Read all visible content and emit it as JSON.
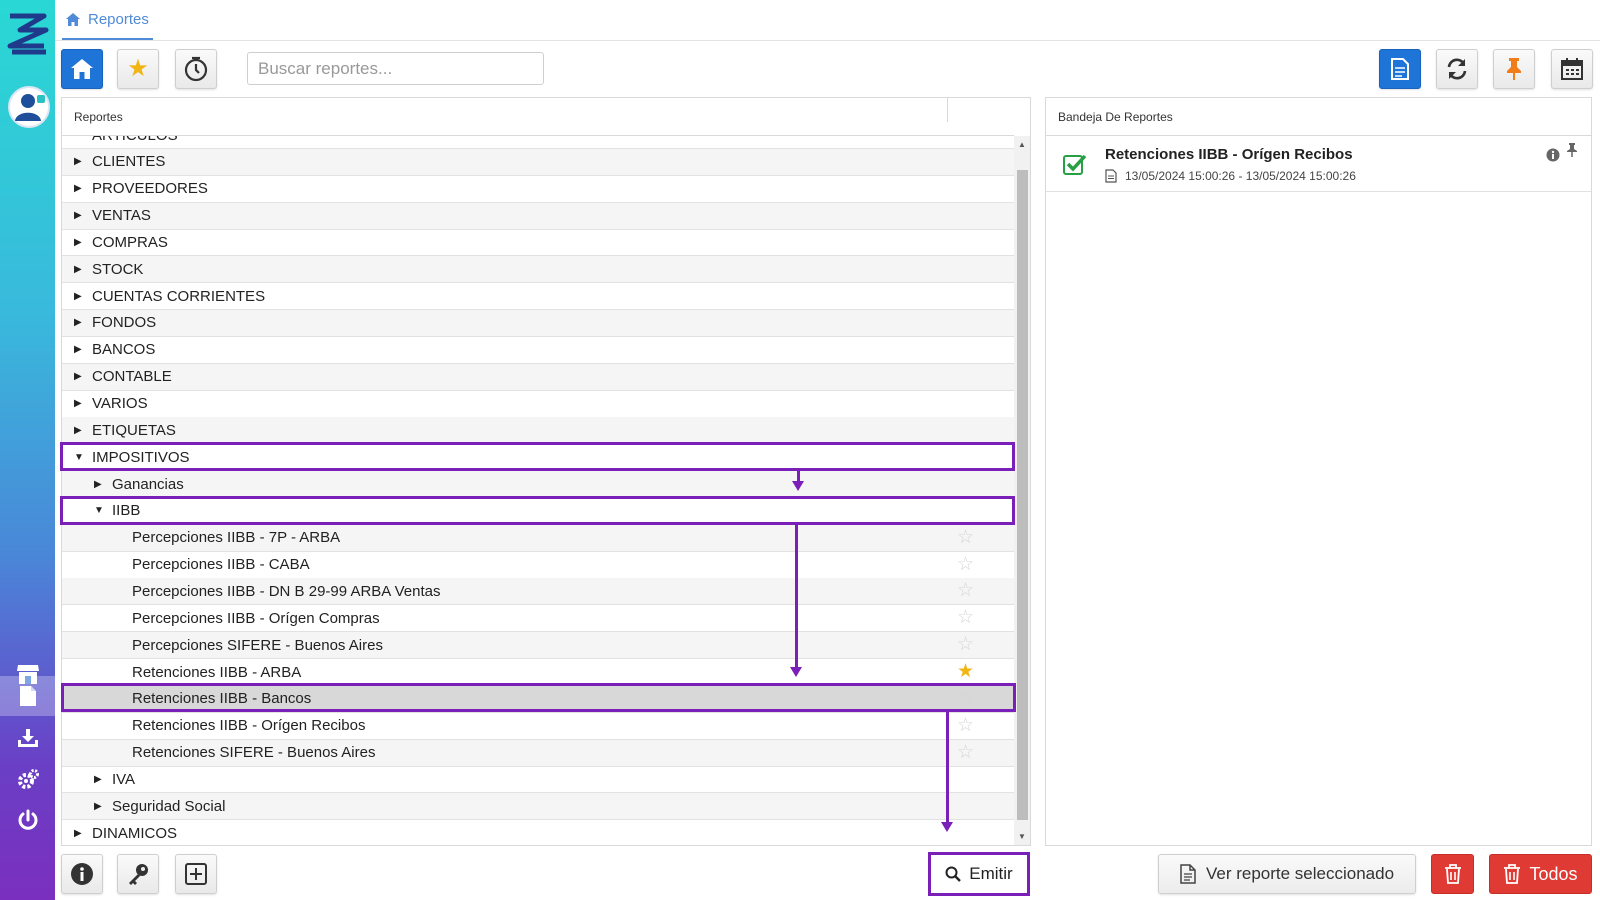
{
  "breadcrumb": {
    "icon": "home-icon",
    "label": "Reportes"
  },
  "search": {
    "placeholder": "Buscar reportes..."
  },
  "reports_panel": {
    "header": "Reportes"
  },
  "tree": [
    {
      "label": "ARTICULOS",
      "level": 0,
      "caret": "",
      "star": ""
    },
    {
      "label": "CLIENTES",
      "level": 0,
      "caret": "▶",
      "star": ""
    },
    {
      "label": "PROVEEDORES",
      "level": 0,
      "caret": "▶",
      "star": ""
    },
    {
      "label": "VENTAS",
      "level": 0,
      "caret": "▶",
      "star": ""
    },
    {
      "label": "COMPRAS",
      "level": 0,
      "caret": "▶",
      "star": ""
    },
    {
      "label": "STOCK",
      "level": 0,
      "caret": "▶",
      "star": ""
    },
    {
      "label": "CUENTAS CORRIENTES",
      "level": 0,
      "caret": "▶",
      "star": ""
    },
    {
      "label": "FONDOS",
      "level": 0,
      "caret": "▶",
      "star": ""
    },
    {
      "label": "BANCOS",
      "level": 0,
      "caret": "▶",
      "star": ""
    },
    {
      "label": "CONTABLE",
      "level": 0,
      "caret": "▶",
      "star": ""
    },
    {
      "label": "VARIOS",
      "level": 0,
      "caret": "▶",
      "star": ""
    },
    {
      "label": "ETIQUETAS",
      "level": 0,
      "caret": "▶",
      "star": ""
    },
    {
      "label": "IMPOSITIVOS",
      "level": 0,
      "caret": "▼",
      "star": ""
    },
    {
      "label": "Ganancias",
      "level": 1,
      "caret": "▶",
      "star": ""
    },
    {
      "label": "IIBB",
      "level": 1,
      "caret": "▼",
      "star": ""
    },
    {
      "label": "Percepciones IIBB - 7P - ARBA",
      "level": 2,
      "caret": "",
      "star": "☆"
    },
    {
      "label": "Percepciones IIBB - CABA",
      "level": 2,
      "caret": "",
      "star": "☆"
    },
    {
      "label": "Percepciones IIBB - DN B 29-99 ARBA Ventas",
      "level": 2,
      "caret": "",
      "star": "☆"
    },
    {
      "label": "Percepciones IIBB - Orígen Compras",
      "level": 2,
      "caret": "",
      "star": "☆"
    },
    {
      "label": "Percepciones SIFERE - Buenos Aires",
      "level": 2,
      "caret": "",
      "star": "☆"
    },
    {
      "label": "Retenciones IIBB - ARBA",
      "level": 2,
      "caret": "",
      "star": "★"
    },
    {
      "label": "Retenciones IIBB - Bancos",
      "level": 2,
      "caret": "",
      "star": "☆"
    },
    {
      "label": "Retenciones IIBB - Orígen Recibos",
      "level": 2,
      "caret": "",
      "star": "☆"
    },
    {
      "label": "Retenciones SIFERE - Buenos Aires",
      "level": 2,
      "caret": "",
      "star": "☆"
    },
    {
      "label": "IVA",
      "level": 1,
      "caret": "▶",
      "star": ""
    },
    {
      "label": "Seguridad Social",
      "level": 1,
      "caret": "▶",
      "star": ""
    },
    {
      "label": "DINAMICOS",
      "level": 0,
      "caret": "▶",
      "star": ""
    }
  ],
  "selected_report": "Retenciones IIBB - Bancos",
  "favorite_report": "Retenciones IIBB - ARBA",
  "emit_button": {
    "label": "Emitir"
  },
  "tray": {
    "header": "Bandeja De Reportes",
    "items": [
      {
        "title": "Retenciones IIBB - Orígen Recibos",
        "dates": "13/05/2024 15:00:26 - 13/05/2024 15:00:26",
        "status": "completed"
      }
    ]
  },
  "view_button": {
    "label": "Ver reporte seleccionado"
  },
  "delete_all_button": {
    "label": "Todos"
  },
  "colors": {
    "primary": "#1f74d8",
    "highlight": "#7a1fb8",
    "danger": "#e03a34",
    "success": "#27a043",
    "star": "#f1b514"
  }
}
